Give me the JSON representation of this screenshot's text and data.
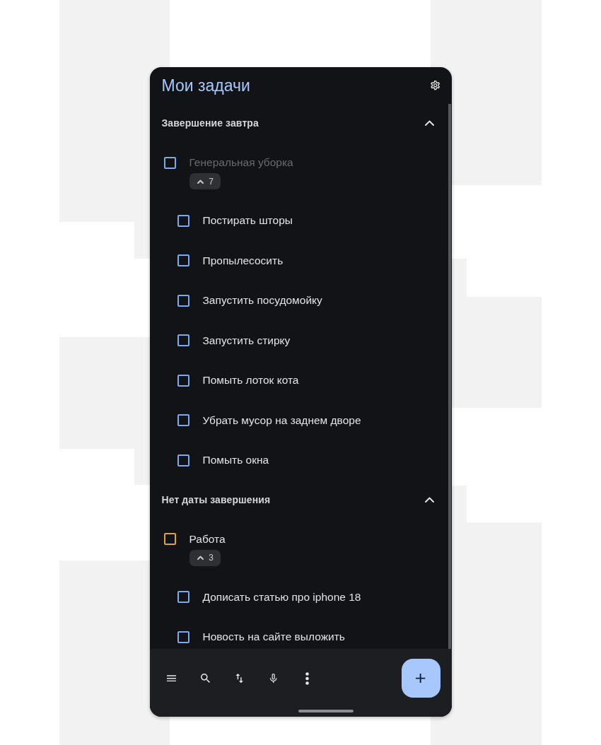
{
  "app_bar": {
    "title": "Мои задачи"
  },
  "sections": [
    {
      "title": "Завершение завтра",
      "expanded": true,
      "tasks": [
        {
          "title": "Генеральная уборка",
          "checked": false,
          "dimmed": true,
          "color": "#7aaaf0",
          "count": "7",
          "expanded": true,
          "children": [
            {
              "title": "Постирать шторы",
              "checked": false,
              "dimmed": false,
              "color": "#7aaaf0"
            },
            {
              "title": "Пропылесосить",
              "checked": false,
              "dimmed": false,
              "color": "#7aaaf0"
            },
            {
              "title": "Запустить посудомойку",
              "checked": false,
              "dimmed": false,
              "color": "#7aaaf0"
            },
            {
              "title": "Запустить стирку",
              "checked": false,
              "dimmed": false,
              "color": "#7aaaf0"
            },
            {
              "title": "Помыть лоток кота",
              "checked": false,
              "dimmed": false,
              "color": "#7aaaf0"
            },
            {
              "title": "Убрать мусор на заднем дворе",
              "checked": false,
              "dimmed": false,
              "color": "#7aaaf0"
            },
            {
              "title": "Помыть окна",
              "checked": false,
              "dimmed": false,
              "color": "#7aaaf0"
            }
          ]
        }
      ]
    },
    {
      "title": "Нет даты завершения",
      "expanded": true,
      "tasks": [
        {
          "title": "Работа",
          "checked": false,
          "dimmed": false,
          "color": "#d9a830",
          "count": "3",
          "expanded": true,
          "children": [
            {
              "title": "Дописать статью про iphone 18",
              "checked": false,
              "dimmed": false,
              "color": "#7aaaf0"
            },
            {
              "title": "Новость на сайте выложить",
              "checked": false,
              "dimmed": false,
              "color": "#7aaaf0"
            }
          ]
        }
      ]
    }
  ]
}
